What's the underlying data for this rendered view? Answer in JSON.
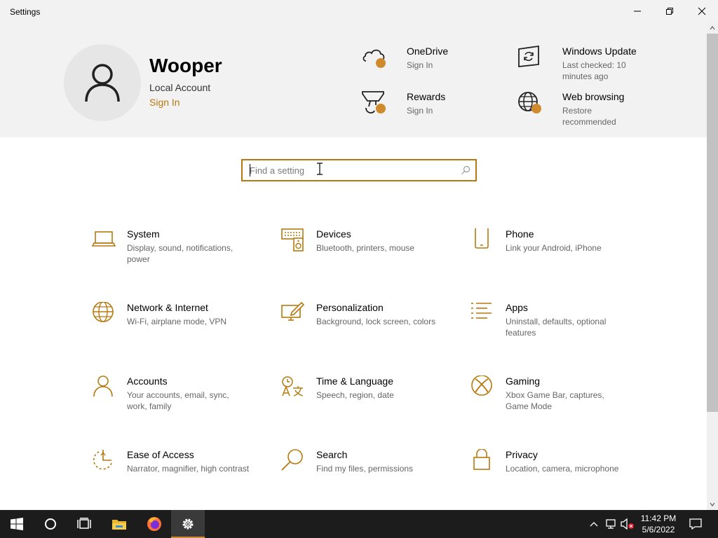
{
  "window": {
    "title": "Settings"
  },
  "account": {
    "name": "Wooper",
    "type": "Local Account",
    "signin_label": "Sign In"
  },
  "header_items": [
    {
      "title": "OneDrive",
      "subtitle": "Sign In",
      "icon": "cloud-icon"
    },
    {
      "title": "Windows Update",
      "subtitle": "Last checked: 10 minutes ago",
      "icon": "windows-update-icon"
    },
    {
      "title": "Rewards",
      "subtitle": "Sign In",
      "icon": "trophy-icon"
    },
    {
      "title": "Web browsing",
      "subtitle": "Restore recommended",
      "icon": "globe-icon"
    }
  ],
  "search": {
    "placeholder": "Find a setting",
    "value": ""
  },
  "categories": [
    {
      "title": "System",
      "subtitle": "Display, sound, notifications, power",
      "icon": "laptop-icon"
    },
    {
      "title": "Devices",
      "subtitle": "Bluetooth, printers, mouse",
      "icon": "keyboard-speaker-icon"
    },
    {
      "title": "Phone",
      "subtitle": "Link your Android, iPhone",
      "icon": "phone-icon"
    },
    {
      "title": "Network & Internet",
      "subtitle": "Wi-Fi, airplane mode, VPN",
      "icon": "globe-icon"
    },
    {
      "title": "Personalization",
      "subtitle": "Background, lock screen, colors",
      "icon": "paint-icon"
    },
    {
      "title": "Apps",
      "subtitle": "Uninstall, defaults, optional features",
      "icon": "apps-list-icon"
    },
    {
      "title": "Accounts",
      "subtitle": "Your accounts, email, sync, work, family",
      "icon": "person-icon"
    },
    {
      "title": "Time & Language",
      "subtitle": "Speech, region, date",
      "icon": "time-language-icon"
    },
    {
      "title": "Gaming",
      "subtitle": "Xbox Game Bar, captures, Game Mode",
      "icon": "xbox-icon"
    },
    {
      "title": "Ease of Access",
      "subtitle": "Narrator, magnifier, high contrast",
      "icon": "ease-of-access-icon"
    },
    {
      "title": "Search",
      "subtitle": "Find my files, permissions",
      "icon": "search-icon"
    },
    {
      "title": "Privacy",
      "subtitle": "Location, camera, microphone",
      "icon": "lock-icon"
    }
  ],
  "taskbar": {
    "clock_time": "11:42 PM",
    "clock_date": "5/6/2022",
    "apps": [
      "start-icon",
      "cortana-icon",
      "task-view-icon",
      "file-explorer-icon",
      "firefox-icon",
      "settings-gear-icon"
    ]
  },
  "colors": {
    "accent": "#b7790f",
    "badge": "#d08a2e",
    "header_bg": "#f2f2f2",
    "taskbar_bg": "#1c1c1c"
  }
}
